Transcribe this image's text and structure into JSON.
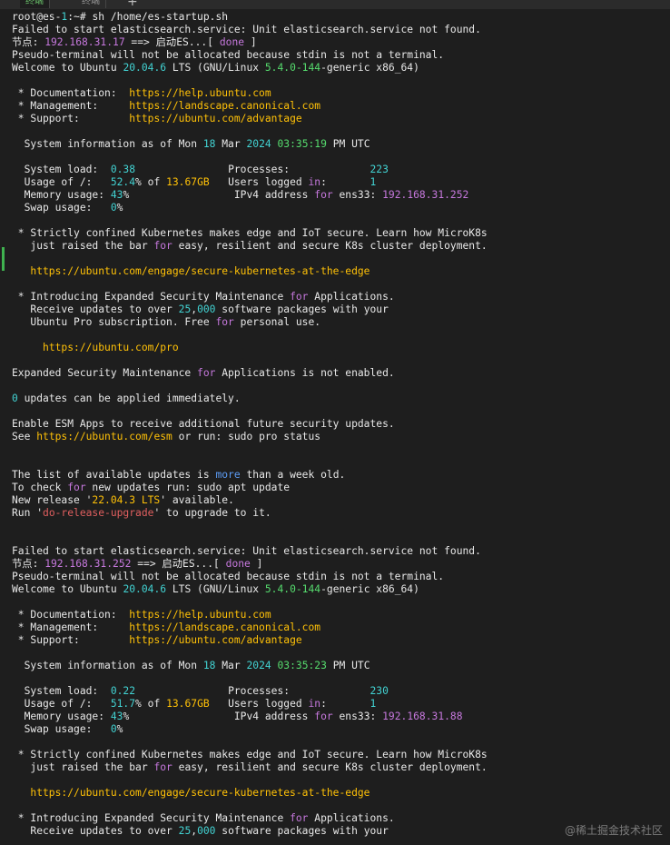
{
  "tabs": [
    {
      "label": "终端",
      "active": true
    },
    {
      "label": "终端",
      "active": false
    }
  ],
  "new_tab_label": "+",
  "colors": {
    "background": "#1e1e1e",
    "text": "#e8e8e8",
    "yellow": "#ffc107",
    "green": "#56dc6e",
    "cyan": "#42d3d3",
    "magenta": "#c678dd",
    "red": "#e05f5f",
    "blue": "#5c9cf5"
  },
  "terminal": {
    "lines": [
      [
        {
          "t": "root@es-"
        },
        {
          "t": "1",
          "c": "c"
        },
        {
          "t": ":~# sh /home/es-startup.sh"
        }
      ],
      [
        {
          "t": "Failed to start elasticsearch.service: Unit elasticsearch.service not found."
        }
      ],
      [
        {
          "t": "节点: "
        },
        {
          "t": "192.168.31.17",
          "c": "m"
        },
        {
          "t": " ==> 启动ES...[ "
        },
        {
          "t": "done",
          "c": "m"
        },
        {
          "t": " ]"
        }
      ],
      [
        {
          "t": "Pseudo-terminal will not be allocated because stdin is not a terminal."
        }
      ],
      [
        {
          "t": "Welcome to Ubuntu "
        },
        {
          "t": "20.04.6",
          "c": "c"
        },
        {
          "t": " LTS (GNU/Linux "
        },
        {
          "t": "5.4.0-144",
          "c": "g"
        },
        {
          "t": "-generic x86_64)"
        }
      ],
      [
        {
          "t": ""
        }
      ],
      [
        {
          "t": " * Documentation:  "
        },
        {
          "t": "https://help.ubuntu.com",
          "c": "y"
        }
      ],
      [
        {
          "t": " * Management:     "
        },
        {
          "t": "https://landscape.canonical.com",
          "c": "y"
        }
      ],
      [
        {
          "t": " * Support:        "
        },
        {
          "t": "https://ubuntu.com/advantage",
          "c": "y"
        }
      ],
      [
        {
          "t": ""
        }
      ],
      [
        {
          "t": "  System information as of Mon "
        },
        {
          "t": "18",
          "c": "c"
        },
        {
          "t": " Mar "
        },
        {
          "t": "2024",
          "c": "c"
        },
        {
          "t": " "
        },
        {
          "t": "03:35:19",
          "c": "g"
        },
        {
          "t": " PM UTC"
        }
      ],
      [
        {
          "t": ""
        }
      ],
      [
        {
          "t": "  System load:  "
        },
        {
          "t": "0.38",
          "c": "c"
        },
        {
          "t": "               Processes:             "
        },
        {
          "t": "223",
          "c": "c"
        }
      ],
      [
        {
          "t": "  Usage of /:   "
        },
        {
          "t": "52.4",
          "c": "c"
        },
        {
          "t": "% of "
        },
        {
          "t": "13.67GB",
          "c": "y"
        },
        {
          "t": "   Users logged "
        },
        {
          "t": "in",
          "c": "m"
        },
        {
          "t": ":       "
        },
        {
          "t": "1",
          "c": "c"
        }
      ],
      [
        {
          "t": "  Memory usage: "
        },
        {
          "t": "43",
          "c": "c"
        },
        {
          "t": "%                 IPv4 address "
        },
        {
          "t": "for",
          "c": "m"
        },
        {
          "t": " ens33: "
        },
        {
          "t": "192.168.31.252",
          "c": "m"
        }
      ],
      [
        {
          "t": "  Swap usage:   "
        },
        {
          "t": "0",
          "c": "c"
        },
        {
          "t": "%"
        }
      ],
      [
        {
          "t": ""
        }
      ],
      [
        {
          "t": " * Strictly confined Kubernetes makes edge and IoT secure. Learn how MicroK8s"
        }
      ],
      [
        {
          "t": "   just raised the bar "
        },
        {
          "t": "for",
          "c": "m"
        },
        {
          "t": " easy, resilient and secure K8s cluster deployment."
        }
      ],
      [
        {
          "t": ""
        }
      ],
      [
        {
          "t": "   "
        },
        {
          "t": "https://ubuntu.com/engage/secure-kubernetes-at-the-edge",
          "c": "y"
        }
      ],
      [
        {
          "t": ""
        }
      ],
      [
        {
          "t": " * Introducing Expanded Security Maintenance "
        },
        {
          "t": "for",
          "c": "m"
        },
        {
          "t": " Applications."
        }
      ],
      [
        {
          "t": "   Receive updates to over "
        },
        {
          "t": "25",
          "c": "c"
        },
        {
          "t": ","
        },
        {
          "t": "000",
          "c": "c"
        },
        {
          "t": " software packages with your"
        }
      ],
      [
        {
          "t": "   Ubuntu Pro subscription. Free "
        },
        {
          "t": "for",
          "c": "m"
        },
        {
          "t": " personal use."
        }
      ],
      [
        {
          "t": ""
        }
      ],
      [
        {
          "t": "     "
        },
        {
          "t": "https://ubuntu.com/pro",
          "c": "y"
        }
      ],
      [
        {
          "t": ""
        }
      ],
      [
        {
          "t": "Expanded Security Maintenance "
        },
        {
          "t": "for",
          "c": "m"
        },
        {
          "t": " Applications is not enabled."
        }
      ],
      [
        {
          "t": ""
        }
      ],
      [
        {
          "t": "0",
          "c": "c"
        },
        {
          "t": " updates can be applied immediately."
        }
      ],
      [
        {
          "t": ""
        }
      ],
      [
        {
          "t": "Enable ESM Apps to receive additional future security updates."
        }
      ],
      [
        {
          "t": "See "
        },
        {
          "t": "https://ubuntu.com/esm",
          "c": "y"
        },
        {
          "t": " or run: sudo pro status"
        }
      ],
      [
        {
          "t": ""
        }
      ],
      [
        {
          "t": ""
        }
      ],
      [
        {
          "t": "The list of available updates is "
        },
        {
          "t": "more",
          "c": "b"
        },
        {
          "t": " than a week old."
        }
      ],
      [
        {
          "t": "To check "
        },
        {
          "t": "for",
          "c": "m"
        },
        {
          "t": " new updates run: sudo apt update"
        }
      ],
      [
        {
          "t": "New release '"
        },
        {
          "t": "22.04.3 LTS",
          "c": "y"
        },
        {
          "t": "' available."
        }
      ],
      [
        {
          "t": "Run '"
        },
        {
          "t": "do-release-upgrade",
          "c": "r"
        },
        {
          "t": "' to upgrade to it."
        }
      ],
      [
        {
          "t": ""
        }
      ],
      [
        {
          "t": ""
        }
      ],
      [
        {
          "t": "Failed to start elasticsearch.service: Unit elasticsearch.service not found."
        }
      ],
      [
        {
          "t": "节点: "
        },
        {
          "t": "192.168.31.252",
          "c": "m"
        },
        {
          "t": " ==> 启动ES...[ "
        },
        {
          "t": "done",
          "c": "m"
        },
        {
          "t": " ]"
        }
      ],
      [
        {
          "t": "Pseudo-terminal will not be allocated because stdin is not a terminal."
        }
      ],
      [
        {
          "t": "Welcome to Ubuntu "
        },
        {
          "t": "20.04.6",
          "c": "c"
        },
        {
          "t": " LTS (GNU/Linux "
        },
        {
          "t": "5.4.0-144",
          "c": "g"
        },
        {
          "t": "-generic x86_64)"
        }
      ],
      [
        {
          "t": ""
        }
      ],
      [
        {
          "t": " * Documentation:  "
        },
        {
          "t": "https://help.ubuntu.com",
          "c": "y"
        }
      ],
      [
        {
          "t": " * Management:     "
        },
        {
          "t": "https://landscape.canonical.com",
          "c": "y"
        }
      ],
      [
        {
          "t": " * Support:        "
        },
        {
          "t": "https://ubuntu.com/advantage",
          "c": "y"
        }
      ],
      [
        {
          "t": ""
        }
      ],
      [
        {
          "t": "  System information as of Mon "
        },
        {
          "t": "18",
          "c": "c"
        },
        {
          "t": " Mar "
        },
        {
          "t": "2024",
          "c": "c"
        },
        {
          "t": " "
        },
        {
          "t": "03:35:23",
          "c": "g"
        },
        {
          "t": " PM UTC"
        }
      ],
      [
        {
          "t": ""
        }
      ],
      [
        {
          "t": "  System load:  "
        },
        {
          "t": "0.22",
          "c": "c"
        },
        {
          "t": "               Processes:             "
        },
        {
          "t": "230",
          "c": "c"
        }
      ],
      [
        {
          "t": "  Usage of /:   "
        },
        {
          "t": "51.7",
          "c": "c"
        },
        {
          "t": "% of "
        },
        {
          "t": "13.67GB",
          "c": "y"
        },
        {
          "t": "   Users logged "
        },
        {
          "t": "in",
          "c": "m"
        },
        {
          "t": ":       "
        },
        {
          "t": "1",
          "c": "c"
        }
      ],
      [
        {
          "t": "  Memory usage: "
        },
        {
          "t": "43",
          "c": "c"
        },
        {
          "t": "%                 IPv4 address "
        },
        {
          "t": "for",
          "c": "m"
        },
        {
          "t": " ens33: "
        },
        {
          "t": "192.168.31.88",
          "c": "m"
        }
      ],
      [
        {
          "t": "  Swap usage:   "
        },
        {
          "t": "0",
          "c": "c"
        },
        {
          "t": "%"
        }
      ],
      [
        {
          "t": ""
        }
      ],
      [
        {
          "t": " * Strictly confined Kubernetes makes edge and IoT secure. Learn how MicroK8s"
        }
      ],
      [
        {
          "t": "   just raised the bar "
        },
        {
          "t": "for",
          "c": "m"
        },
        {
          "t": " easy, resilient and secure K8s cluster deployment."
        }
      ],
      [
        {
          "t": ""
        }
      ],
      [
        {
          "t": "   "
        },
        {
          "t": "https://ubuntu.com/engage/secure-kubernetes-at-the-edge",
          "c": "y"
        }
      ],
      [
        {
          "t": ""
        }
      ],
      [
        {
          "t": " * Introducing Expanded Security Maintenance "
        },
        {
          "t": "for",
          "c": "m"
        },
        {
          "t": " Applications."
        }
      ],
      [
        {
          "t": "   Receive updates to over "
        },
        {
          "t": "25",
          "c": "c"
        },
        {
          "t": ","
        },
        {
          "t": "000",
          "c": "c"
        },
        {
          "t": " software packages with your"
        }
      ]
    ]
  },
  "watermark": "@稀土掘金技术社区"
}
